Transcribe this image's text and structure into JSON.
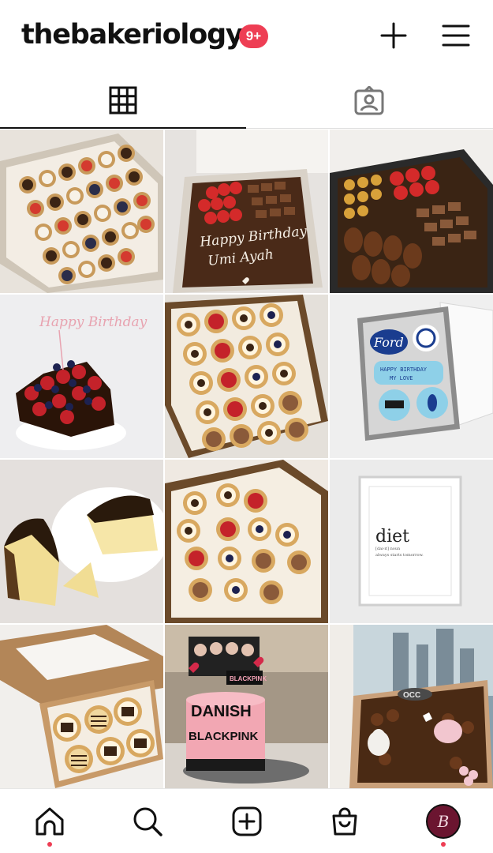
{
  "header": {
    "username": "thebakeriology",
    "notification_badge": "9+",
    "new_post_icon": "plus-icon",
    "menu_icon": "hamburger-menu-icon"
  },
  "tabs": [
    {
      "name": "posts-grid",
      "icon": "grid-icon",
      "active": true
    },
    {
      "name": "tagged",
      "icon": "tagged-person-icon",
      "active": false
    }
  ],
  "posts": {
    "p2": {
      "line1": "Happy Birthday",
      "line2": "Umi Ayah"
    },
    "p4": {
      "topper": "Happy Birthday"
    },
    "p6": {
      "brand": "Ford",
      "line1": "HAPPY BIRTHDAY",
      "line2": "MY LOVE"
    },
    "p9": {
      "word": "diet",
      "phonetic": "[daɪ-ɪt] noun",
      "caption": "always starts tomorrow."
    },
    "p11": {
      "name": "DANISH",
      "band": "BLACKPINK",
      "topper": "BLACKPINK"
    },
    "p12": {
      "plaque": "OCC"
    }
  },
  "bottom_nav": [
    {
      "name": "home",
      "icon": "home-icon",
      "notification_dot": true
    },
    {
      "name": "search",
      "icon": "search-icon"
    },
    {
      "name": "create",
      "icon": "add-square-icon"
    },
    {
      "name": "shop",
      "icon": "shopping-bag-icon"
    },
    {
      "name": "profile",
      "icon": "profile-avatar-icon",
      "notification_dot": true,
      "avatar_letter": "B"
    }
  ],
  "colors": {
    "badge": "#ee3e54",
    "avatar_bg": "#6b1530",
    "active_tab_indicator": "#111111"
  }
}
